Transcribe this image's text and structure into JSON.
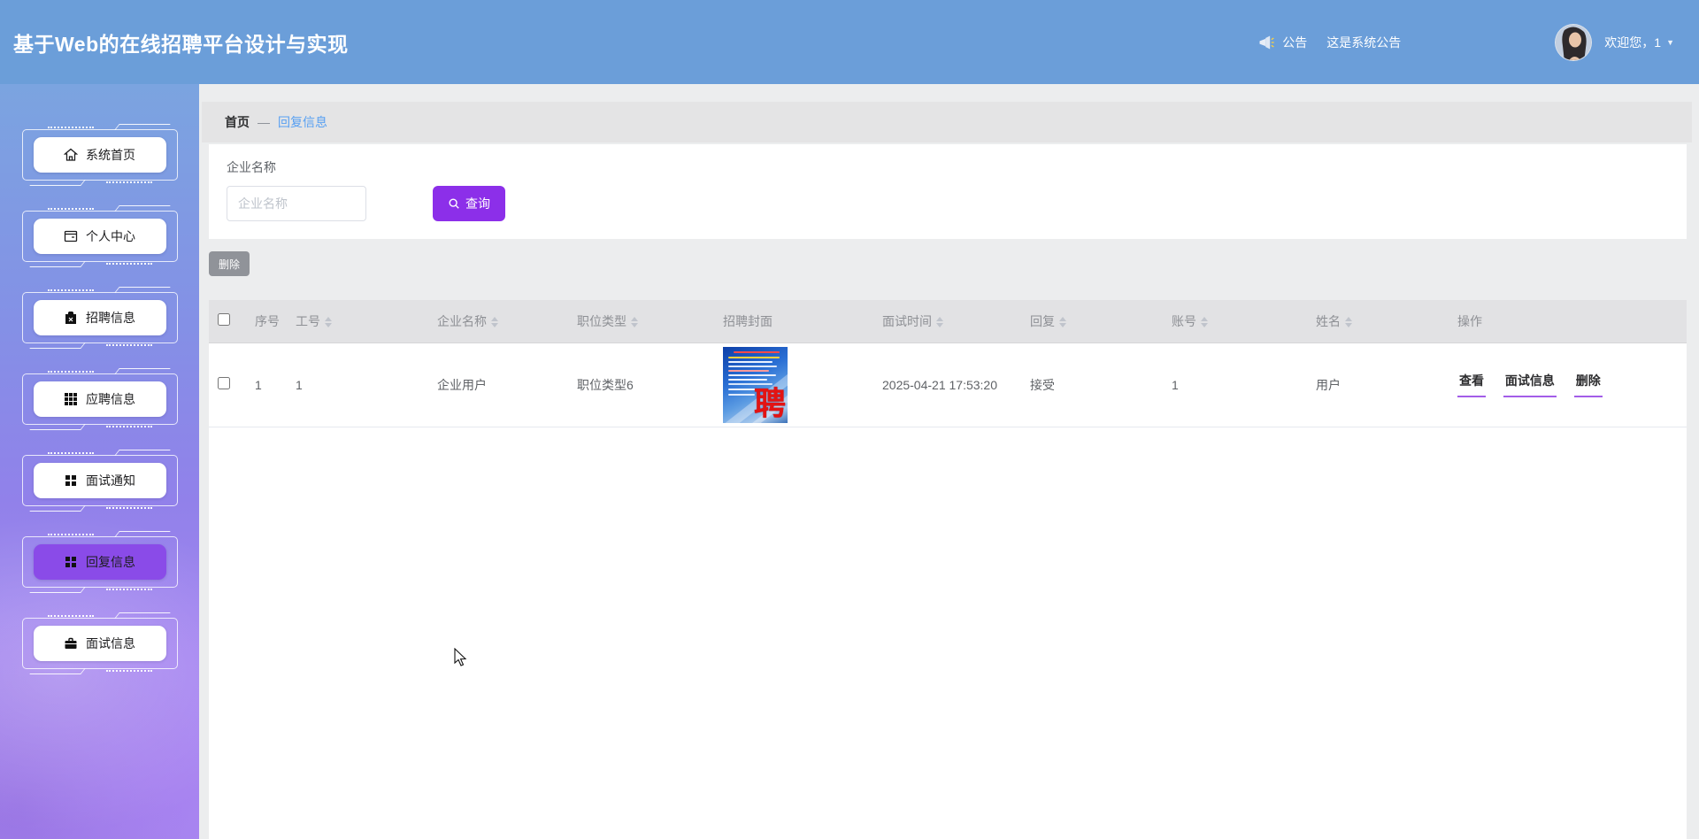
{
  "header": {
    "title": "基于Web的在线招聘平台设计与实现",
    "announcement_label": "公告",
    "announcement_text": "这是系统公告",
    "welcome_text": "欢迎您，1"
  },
  "sidebar": {
    "items": [
      {
        "label": "系统首页",
        "icon": "home-icon",
        "active": false
      },
      {
        "label": "个人中心",
        "icon": "profile-card-icon",
        "active": false
      },
      {
        "label": "招聘信息",
        "icon": "clipboard-icon",
        "active": false
      },
      {
        "label": "应聘信息",
        "icon": "grid-nine-icon",
        "active": false
      },
      {
        "label": "面试通知",
        "icon": "grid-four-icon",
        "active": false
      },
      {
        "label": "回复信息",
        "icon": "grid-four-icon",
        "active": true
      },
      {
        "label": "面试信息",
        "icon": "briefcase-icon",
        "active": false
      }
    ]
  },
  "breadcrumb": {
    "home": "首页",
    "separator": "—",
    "current": "回复信息"
  },
  "search": {
    "label": "企业名称",
    "placeholder": "企业名称",
    "value": "",
    "button": "查询"
  },
  "toolbar": {
    "delete_label": "删除"
  },
  "table": {
    "columns": [
      {
        "label": "序号",
        "sortable": false
      },
      {
        "label": "工号",
        "sortable": true
      },
      {
        "label": "企业名称",
        "sortable": true
      },
      {
        "label": "职位类型",
        "sortable": true
      },
      {
        "label": "招聘封面",
        "sortable": false
      },
      {
        "label": "面试时间",
        "sortable": true
      },
      {
        "label": "回复",
        "sortable": true
      },
      {
        "label": "账号",
        "sortable": true
      },
      {
        "label": "姓名",
        "sortable": true
      },
      {
        "label": "操作",
        "sortable": false
      }
    ],
    "rows": [
      {
        "index": "1",
        "work_id": "1",
        "company": "企业用户",
        "job_type": "职位类型6",
        "cover_glyph": "聘",
        "interview_time": "2025-04-21 17:53:20",
        "reply": "接受",
        "account": "1",
        "name": "用户",
        "actions": {
          "view": "查看",
          "interview_info": "面试信息",
          "delete": "删除"
        }
      }
    ]
  },
  "colors": {
    "header_blue": "#6b9ed9",
    "accent_purple": "#8c2fe9",
    "active_menu_purple": "#8a4be8",
    "link_blue": "#58a0f2",
    "action_underline": "#a35de8",
    "delete_gray": "#909399"
  }
}
